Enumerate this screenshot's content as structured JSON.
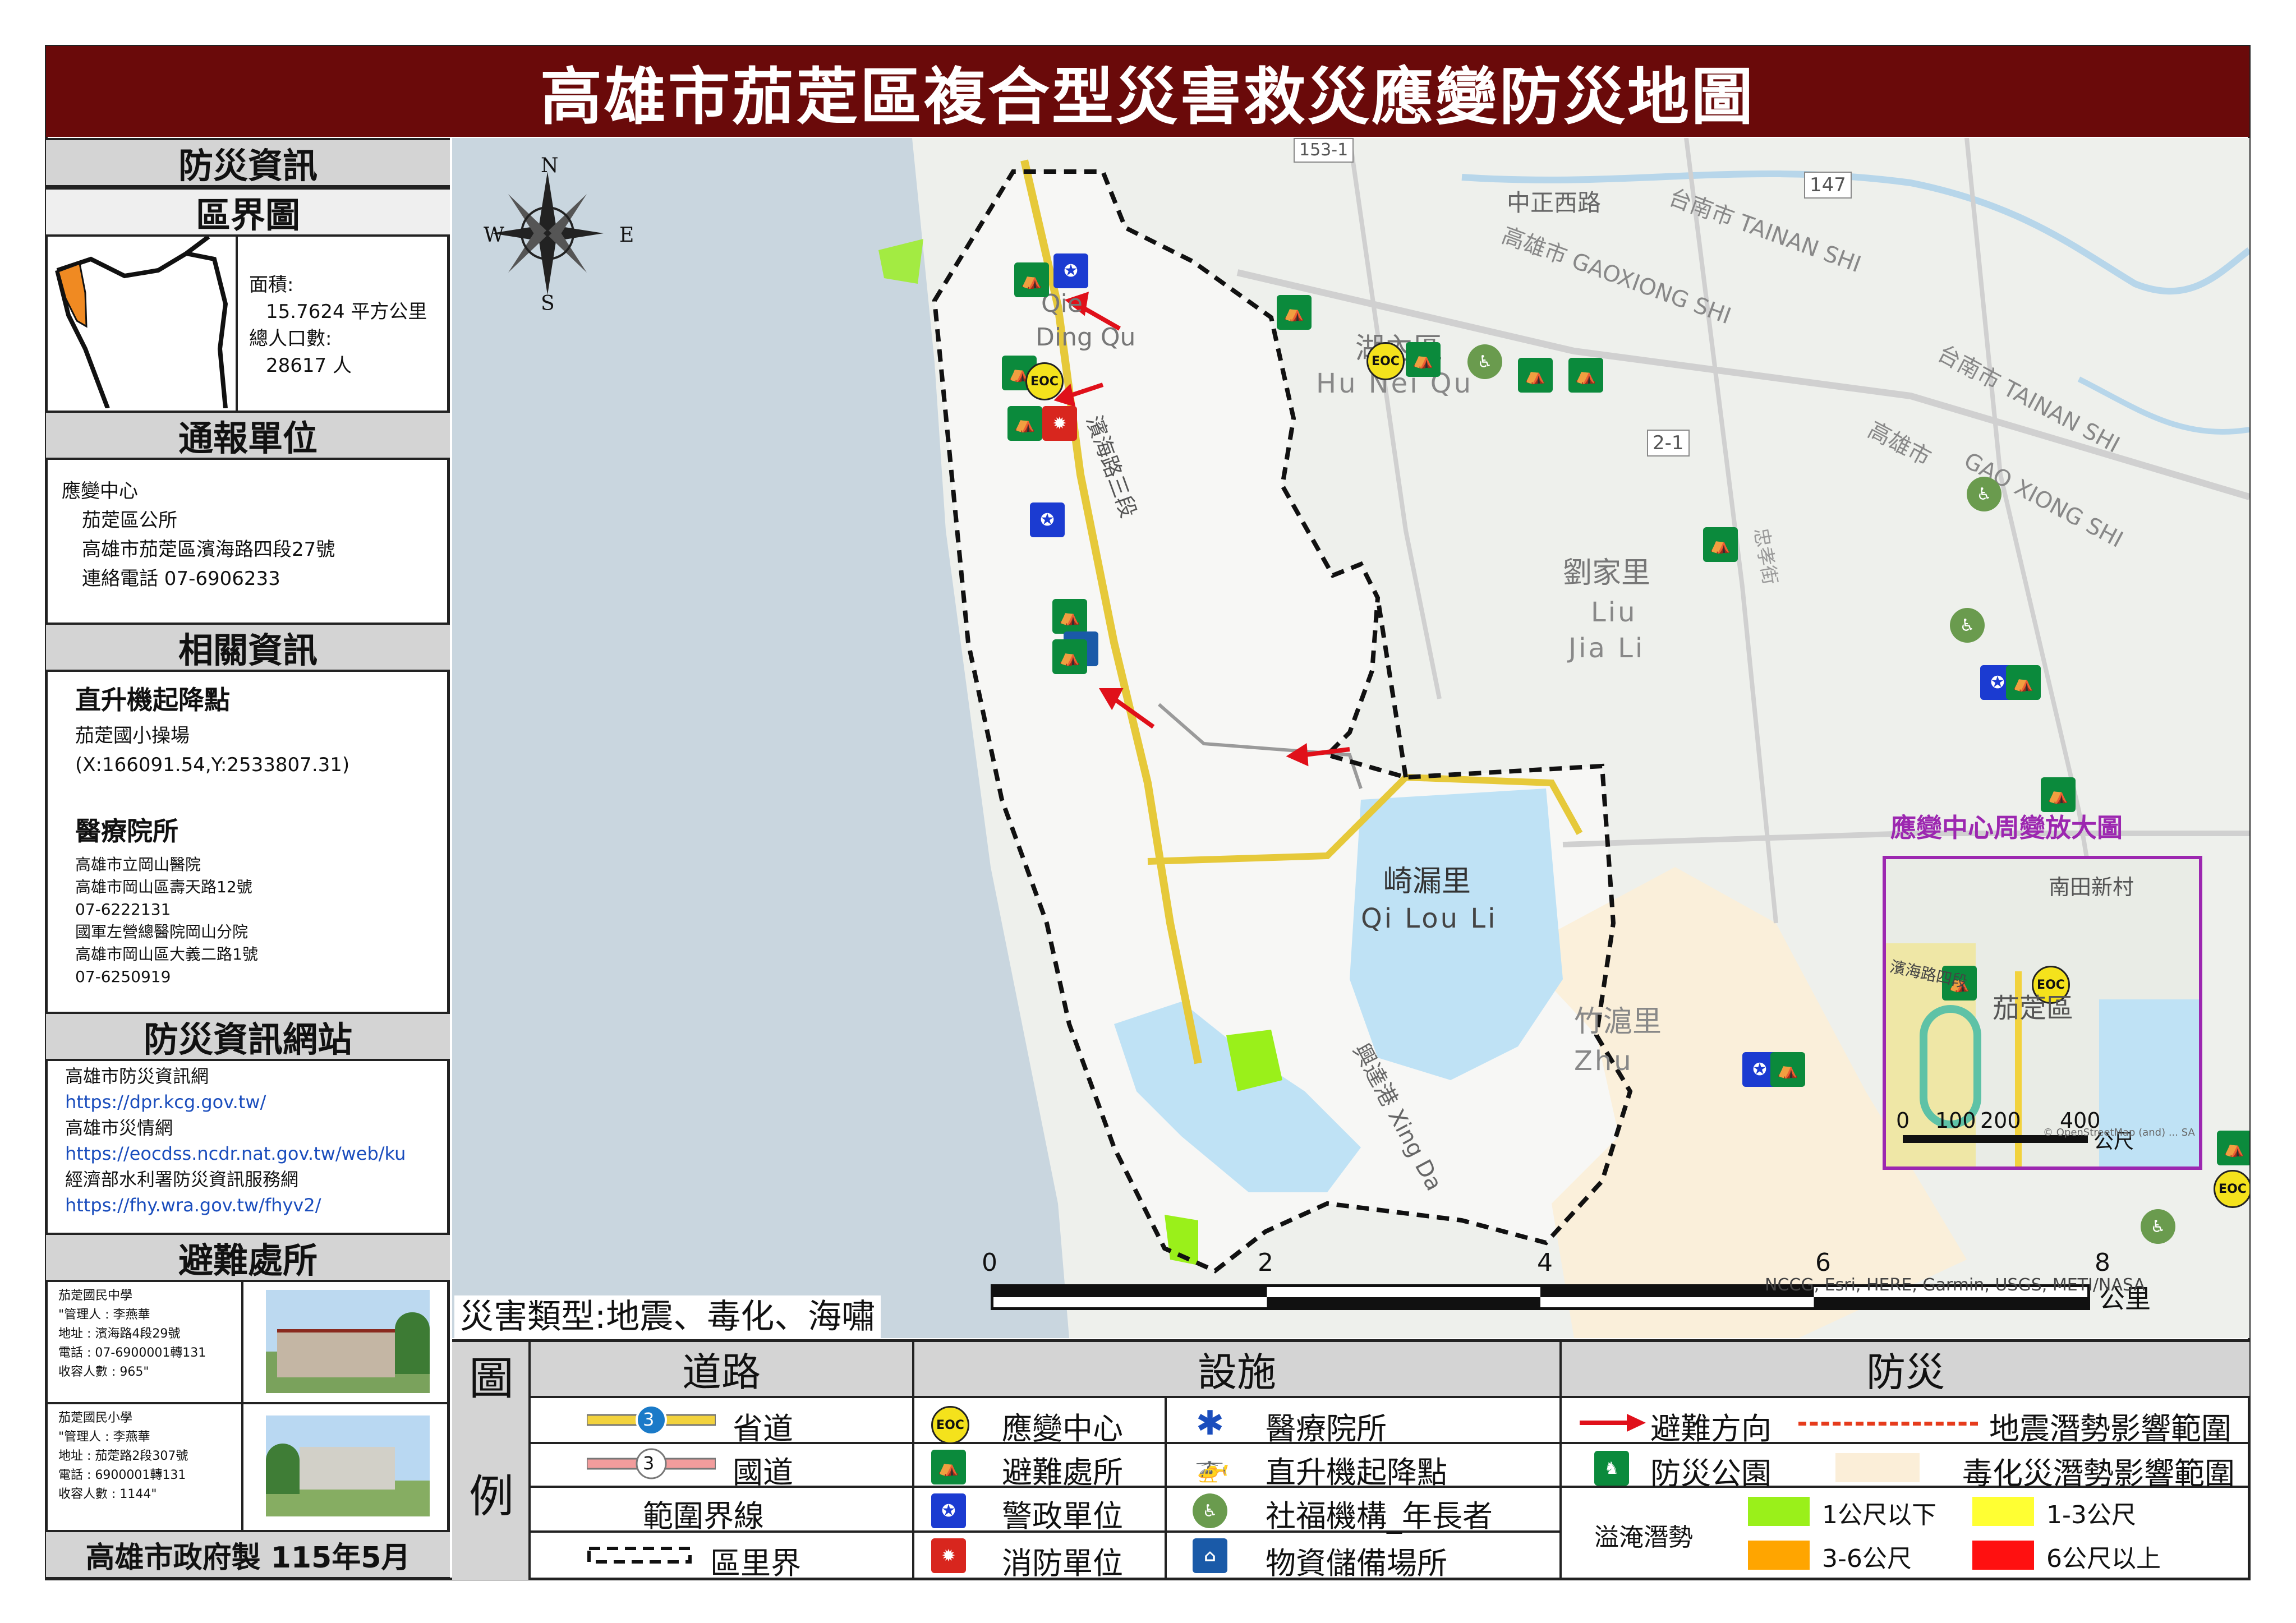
{
  "title": "高雄市茄萣區複合型災害救災應變防災地圖",
  "left": {
    "section_disaster_info": "防災資訊",
    "section_boundary": "區界圖",
    "area_label": "面積:",
    "area_value": "15.7624 平方公里",
    "population_label": "總人口數:",
    "population_value": "28617 人",
    "section_report": "通報單位",
    "report_lines": [
      "應變中心",
      "茄萣區公所",
      "高雄市茄萣區濱海路四段27號",
      "連絡電話 07-6906233"
    ],
    "section_related": "相關資訊",
    "heli_title": "直升機起降點",
    "heli_lines": [
      "茄萣國小操場",
      "(X:166091.54,Y:2533807.31)"
    ],
    "medical_title": "醫療院所",
    "medical_lines": [
      "高雄市立岡山醫院",
      "高雄市岡山區壽天路12號",
      "07-6222131",
      "國軍左營總醫院岡山分院",
      "高雄市岡山區大義二路1號",
      "07-6250919"
    ],
    "section_websites": "防災資訊網站",
    "websites": [
      {
        "name": "高雄市防災資訊網",
        "url": "https://dpr.kcg.gov.tw/"
      },
      {
        "name": "高雄市災情網",
        "url": "https://eocdss.ncdr.nat.gov.tw/web/ku"
      },
      {
        "name": "經濟部水利署防災資訊服務網",
        "url": "https://fhy.wra.gov.tw/fhyv2/"
      }
    ],
    "section_shelter": "避難處所",
    "shelters": [
      {
        "lines": [
          "茄萣國民中學",
          "\"管理人 : 李燕華",
          "地址 : 濱海路4段29號",
          "電話 : 07-6900001轉131",
          "收容人數 : 965\""
        ]
      },
      {
        "lines": [
          "茄萣國民小學",
          "\"管理人 : 李燕華",
          "地址 : 茄萣路2段307號",
          "電話 : 6900001轉131",
          "收容人數 : 1144\""
        ]
      }
    ],
    "footer": "高雄市政府製 115年5月"
  },
  "map": {
    "disaster_types": "災害類型:地震、毒化、海嘯",
    "compass": {
      "n": "N",
      "s": "S",
      "e": "E",
      "w": "W"
    },
    "scale_ticks": [
      "0",
      "2",
      "4",
      "6",
      "8"
    ],
    "scale_unit": "公里",
    "attribution": "NCCG, Esri, HERE, Garmin, USGS, METI/NASA",
    "places": [
      {
        "zh": "崎漏里",
        "en": "Qi Lou Li"
      },
      {
        "zh": "劉家里",
        "en": "Liu",
        "en2": "Jia Li"
      },
      {
        "zh": "竹滬里",
        "en": "Zhu"
      },
      {
        "zh": "湖內區",
        "en": "Hu Nei Qu"
      },
      {
        "zh": "區",
        "en": "Qie",
        "en2": "Ding Qu"
      }
    ],
    "roads": [
      "中正西路",
      "台南市 TAINAN SHI",
      "高雄市 GAOXIONG SHI",
      "台南市 TAINAN SHI",
      "高雄市",
      "GAO XIONG SHI",
      "興達港 Xing Da",
      "濱海路三段",
      "忠孝街"
    ],
    "road_numbers": [
      "147",
      "2-1",
      "153-1"
    ],
    "inset": {
      "title": "應變中心周變放大圖",
      "labels": [
        "南田新村",
        "茄萣區",
        "濱海路四段"
      ],
      "scale": [
        "0",
        "100",
        "200",
        "400"
      ],
      "scale_unit": "公尺",
      "attribution": "© OpenStreetMap (and) ... SA"
    }
  },
  "legend": {
    "label_tu": "圖",
    "label_li": "例",
    "col_road": "道路",
    "col_facility": "設施",
    "col_prevention": "防災",
    "provincial": "省道",
    "national": "國道",
    "boundary_head": "範圍界線",
    "village": "區里界",
    "eoc": "應變中心",
    "shelter": "避難處所",
    "police": "警政單位",
    "fire": "消防單位",
    "hospital": "醫療院所",
    "heliport": "直升機起降點",
    "elderly": "社福機構_年長者",
    "storage": "物資儲備場所",
    "evac_dir": "避難方向",
    "quake": "地震潛勢影響範圍",
    "park": "防災公園",
    "toxic": "毒化災潛勢影響範圍",
    "flood": "溢淹潛勢",
    "flood_levels": [
      "1公尺以下",
      "1-3公尺",
      "3-6公尺",
      "6公尺以上"
    ],
    "eoc_badge": "EOC",
    "shield_3": "3",
    "colors": {
      "flood1": "#9af01a",
      "flood2": "#ffff33",
      "flood3": "#ffa500",
      "flood4": "#ff1010",
      "toxic": "#fbeed8",
      "quake": "#e63b1c",
      "evac": "#e0101a"
    }
  }
}
